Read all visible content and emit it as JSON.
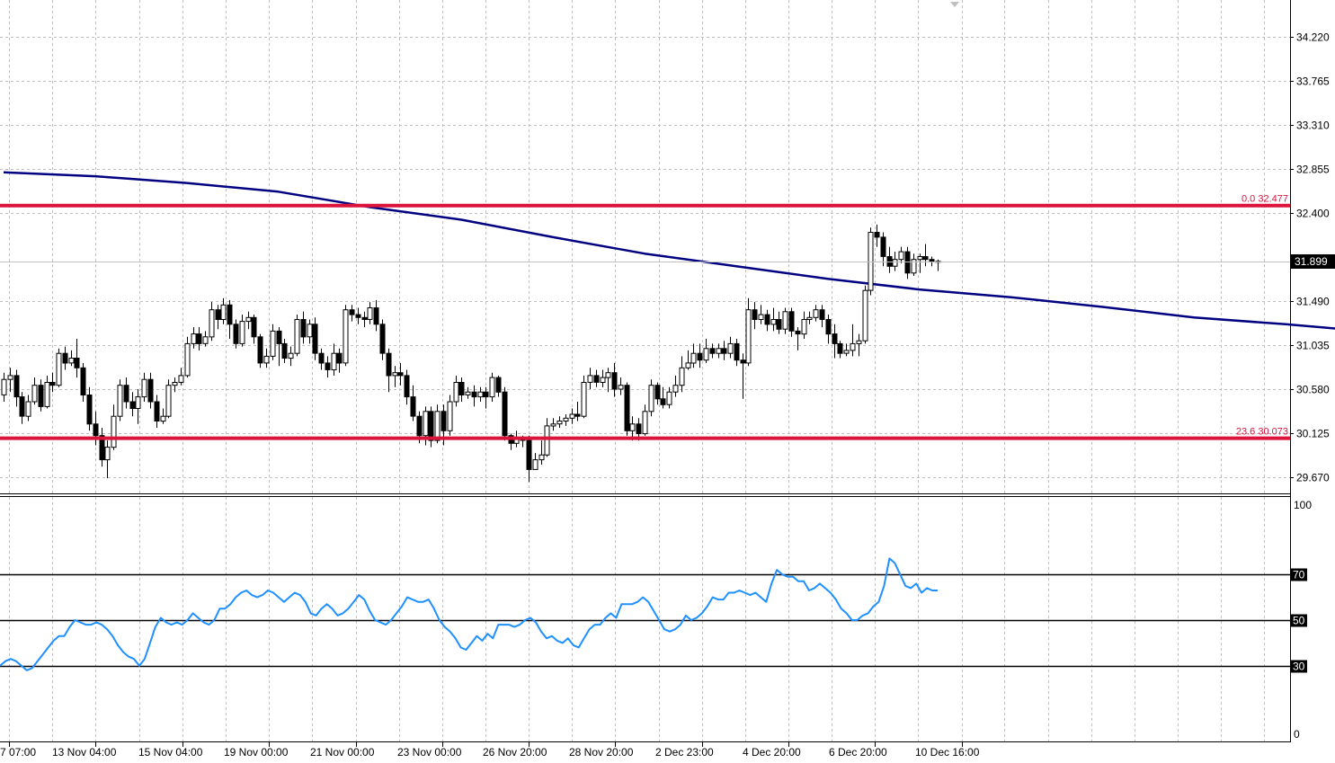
{
  "chart_data": [
    {
      "type": "candlestick",
      "panel": "price",
      "ylim": [
        29.45,
        34.6
      ],
      "y_ticks": [
        "34.220",
        "33.765",
        "33.310",
        "32.855",
        "32.400",
        "31.490",
        "31.035",
        "30.580",
        "30.125",
        "29.670"
      ],
      "current_price_label": "31.899",
      "current_price": 31.899,
      "candles": [
        [
          30.52,
          30.68,
          30.45,
          30.75
        ],
        [
          30.68,
          30.72,
          30.55,
          30.8
        ],
        [
          30.72,
          30.5,
          30.4,
          30.78
        ],
        [
          30.5,
          30.3,
          30.22,
          30.55
        ],
        [
          30.3,
          30.45,
          30.25,
          30.52
        ],
        [
          30.45,
          30.62,
          30.42,
          30.7
        ],
        [
          30.62,
          30.4,
          30.35,
          30.68
        ],
        [
          30.4,
          30.65,
          30.38,
          30.72
        ],
        [
          30.65,
          30.62,
          30.55,
          30.75
        ],
        [
          30.62,
          30.95,
          30.6,
          31.0
        ],
        [
          30.95,
          30.85,
          30.78,
          31.02
        ],
        [
          30.85,
          30.9,
          30.82,
          30.98
        ],
        [
          30.9,
          30.8,
          30.7,
          31.1
        ],
        [
          30.8,
          30.52,
          30.45,
          30.85
        ],
        [
          30.52,
          30.22,
          30.15,
          30.6
        ],
        [
          30.22,
          30.1,
          30.0,
          30.35
        ],
        [
          30.1,
          29.85,
          29.78,
          30.18
        ],
        [
          29.85,
          29.98,
          29.66,
          30.05
        ],
        [
          29.98,
          30.3,
          29.95,
          30.42
        ],
        [
          30.3,
          30.62,
          30.25,
          30.68
        ],
        [
          30.62,
          30.45,
          30.38,
          30.7
        ],
        [
          30.45,
          30.38,
          30.3,
          30.55
        ],
        [
          30.38,
          30.5,
          30.22,
          30.58
        ],
        [
          30.5,
          30.68,
          30.45,
          30.75
        ],
        [
          30.68,
          30.45,
          30.38,
          30.75
        ],
        [
          30.45,
          30.25,
          30.18,
          30.52
        ],
        [
          30.25,
          30.3,
          30.22,
          30.38
        ],
        [
          30.3,
          30.62,
          30.28,
          30.68
        ],
        [
          30.62,
          30.65,
          30.55,
          30.7
        ],
        [
          30.65,
          30.72,
          30.62,
          30.8
        ],
        [
          30.72,
          31.05,
          30.7,
          31.12
        ],
        [
          31.05,
          31.15,
          31.0,
          31.22
        ],
        [
          31.15,
          31.05,
          30.98,
          31.22
        ],
        [
          31.05,
          31.12,
          31.02,
          31.18
        ],
        [
          31.12,
          31.4,
          31.08,
          31.48
        ],
        [
          31.4,
          31.3,
          31.2,
          31.45
        ],
        [
          31.3,
          31.45,
          31.25,
          31.52
        ],
        [
          31.45,
          31.25,
          31.1,
          31.5
        ],
        [
          31.25,
          31.05,
          31.0,
          31.3
        ],
        [
          31.05,
          31.28,
          31.02,
          31.35
        ],
        [
          31.28,
          31.32,
          31.2,
          31.38
        ],
        [
          31.32,
          31.12,
          31.05,
          31.35
        ],
        [
          31.12,
          30.85,
          30.8,
          31.15
        ],
        [
          30.85,
          30.92,
          30.8,
          31.0
        ],
        [
          30.92,
          31.18,
          30.88,
          31.25
        ],
        [
          31.18,
          31.05,
          30.82,
          31.22
        ],
        [
          31.05,
          30.9,
          30.85,
          31.1
        ],
        [
          30.9,
          30.95,
          30.82,
          31.02
        ],
        [
          30.95,
          31.3,
          30.92,
          31.35
        ],
        [
          31.3,
          31.12,
          31.05,
          31.38
        ],
        [
          31.12,
          31.25,
          31.05,
          31.3
        ],
        [
          31.25,
          30.95,
          30.88,
          31.32
        ],
        [
          30.95,
          30.85,
          30.78,
          31.0
        ],
        [
          30.85,
          30.78,
          30.7,
          30.92
        ],
        [
          30.78,
          30.95,
          30.72,
          31.05
        ],
        [
          30.95,
          30.85,
          30.75,
          31.0
        ],
        [
          30.85,
          31.4,
          30.82,
          31.45
        ],
        [
          31.4,
          31.35,
          31.28,
          31.45
        ],
        [
          31.35,
          31.32,
          31.25,
          31.42
        ],
        [
          31.32,
          31.3,
          31.22,
          31.38
        ],
        [
          31.3,
          31.42,
          31.25,
          31.48
        ],
        [
          31.42,
          31.25,
          31.18,
          31.5
        ],
        [
          31.25,
          30.95,
          30.88,
          31.3
        ],
        [
          30.95,
          30.72,
          30.55,
          31.0
        ],
        [
          30.72,
          30.75,
          30.6,
          30.82
        ],
        [
          30.75,
          30.72,
          30.62,
          30.85
        ],
        [
          30.72,
          30.5,
          30.42,
          30.78
        ],
        [
          30.5,
          30.3,
          30.25,
          30.62
        ],
        [
          30.3,
          30.1,
          30.02,
          30.35
        ],
        [
          30.1,
          30.35,
          30.0,
          30.4
        ],
        [
          30.35,
          30.05,
          29.98,
          30.4
        ],
        [
          30.05,
          30.35,
          30.02,
          30.42
        ],
        [
          30.35,
          30.15,
          30.0,
          30.42
        ],
        [
          30.15,
          30.45,
          30.1,
          30.52
        ],
        [
          30.45,
          30.65,
          30.4,
          30.72
        ],
        [
          30.65,
          30.52,
          30.45,
          30.7
        ],
        [
          30.52,
          30.55,
          30.48,
          30.6
        ],
        [
          30.55,
          30.5,
          30.4,
          30.62
        ],
        [
          30.5,
          30.55,
          30.45,
          30.6
        ],
        [
          30.55,
          30.5,
          30.38,
          30.6
        ],
        [
          30.5,
          30.7,
          30.45,
          30.75
        ],
        [
          30.7,
          30.55,
          30.5,
          30.72
        ],
        [
          30.55,
          30.1,
          30.05,
          30.6
        ],
        [
          30.1,
          30.02,
          29.95,
          30.12
        ],
        [
          30.02,
          30.08,
          29.98,
          30.15
        ],
        [
          30.08,
          30.05,
          29.98,
          30.1
        ],
        [
          30.05,
          29.75,
          29.62,
          30.1
        ],
        [
          29.75,
          29.85,
          29.78,
          29.92
        ],
        [
          29.85,
          29.9,
          29.8,
          30.05
        ],
        [
          29.9,
          30.2,
          29.88,
          30.28
        ],
        [
          30.2,
          30.22,
          30.15,
          30.28
        ],
        [
          30.22,
          30.25,
          30.18,
          30.3
        ],
        [
          30.25,
          30.28,
          30.2,
          30.32
        ],
        [
          30.28,
          30.32,
          30.22,
          30.38
        ],
        [
          30.32,
          30.3,
          30.25,
          30.45
        ],
        [
          30.3,
          30.65,
          30.28,
          30.72
        ],
        [
          30.65,
          30.72,
          30.58,
          30.8
        ],
        [
          30.72,
          30.65,
          30.6,
          30.78
        ],
        [
          30.65,
          30.7,
          30.6,
          30.78
        ],
        [
          30.7,
          30.75,
          30.55,
          30.8
        ],
        [
          30.75,
          30.58,
          30.5,
          30.85
        ],
        [
          30.58,
          30.62,
          30.52,
          30.7
        ],
        [
          30.62,
          30.15,
          30.1,
          30.65
        ],
        [
          30.15,
          30.22,
          30.05,
          30.3
        ],
        [
          30.22,
          30.12,
          30.05,
          30.28
        ],
        [
          30.12,
          30.35,
          30.1,
          30.42
        ],
        [
          30.35,
          30.62,
          30.3,
          30.68
        ],
        [
          30.62,
          30.48,
          30.42,
          30.65
        ],
        [
          30.48,
          30.42,
          30.38,
          30.6
        ],
        [
          30.42,
          30.55,
          30.38,
          30.6
        ],
        [
          30.55,
          30.62,
          30.5,
          30.72
        ],
        [
          30.62,
          30.8,
          30.55,
          30.92
        ],
        [
          30.8,
          30.85,
          30.78,
          30.98
        ],
        [
          30.85,
          30.95,
          30.8,
          31.05
        ],
        [
          30.95,
          30.88,
          30.8,
          31.05
        ],
        [
          30.88,
          31.0,
          30.85,
          31.1
        ],
        [
          31.0,
          30.95,
          30.9,
          31.05
        ],
        [
          30.95,
          31.0,
          30.9,
          31.05
        ],
        [
          31.0,
          30.95,
          30.88,
          31.08
        ],
        [
          30.95,
          31.05,
          30.9,
          31.12
        ],
        [
          31.05,
          30.88,
          30.82,
          31.1
        ],
        [
          30.88,
          30.85,
          30.48,
          30.95
        ],
        [
          30.85,
          31.4,
          30.82,
          31.52
        ],
        [
          31.4,
          31.3,
          31.2,
          31.48
        ],
        [
          31.3,
          31.35,
          31.25,
          31.45
        ],
        [
          31.35,
          31.25,
          31.18,
          31.4
        ],
        [
          31.25,
          31.3,
          31.18,
          31.42
        ],
        [
          31.3,
          31.2,
          31.15,
          31.38
        ],
        [
          31.2,
          31.38,
          31.15,
          31.42
        ],
        [
          31.38,
          31.18,
          31.12,
          31.42
        ],
        [
          31.18,
          31.15,
          30.98,
          31.22
        ],
        [
          31.15,
          31.3,
          31.1,
          31.38
        ],
        [
          31.3,
          31.32,
          31.25,
          31.38
        ],
        [
          31.32,
          31.4,
          31.28,
          31.45
        ],
        [
          31.4,
          31.3,
          31.22,
          31.45
        ],
        [
          31.3,
          31.15,
          31.05,
          31.35
        ],
        [
          31.15,
          31.05,
          30.9,
          31.25
        ],
        [
          31.05,
          30.95,
          30.9,
          31.08
        ],
        [
          30.95,
          30.98,
          30.92,
          31.05
        ],
        [
          30.98,
          31.05,
          30.92,
          31.25
        ],
        [
          31.05,
          31.08,
          30.92,
          31.15
        ],
        [
          31.08,
          31.6,
          31.05,
          31.65
        ],
        [
          31.6,
          32.2,
          31.55,
          32.25
        ],
        [
          32.2,
          32.15,
          32.05,
          32.28
        ],
        [
          32.15,
          31.95,
          31.85,
          32.2
        ],
        [
          31.95,
          31.85,
          31.78,
          32.05
        ],
        [
          31.85,
          31.92,
          31.8,
          32.0
        ],
        [
          31.92,
          32.0,
          31.88,
          32.05
        ],
        [
          32.0,
          31.78,
          31.72,
          32.05
        ],
        [
          31.78,
          31.92,
          31.75,
          31.98
        ],
        [
          31.92,
          31.95,
          31.78,
          31.98
        ],
        [
          31.95,
          31.92,
          31.85,
          32.08
        ],
        [
          31.92,
          31.9,
          31.85,
          31.95
        ],
        [
          31.9,
          31.899,
          31.8,
          31.92
        ]
      ],
      "moving_average": [
        [
          0,
          32.82
        ],
        [
          15,
          32.78
        ],
        [
          30,
          32.71
        ],
        [
          45,
          32.62
        ],
        [
          60,
          32.46
        ],
        [
          75,
          32.33
        ],
        [
          90,
          32.15
        ],
        [
          105,
          31.98
        ],
        [
          120,
          31.85
        ],
        [
          135,
          31.72
        ],
        [
          150,
          31.61
        ],
        [
          165,
          31.53
        ],
        [
          180,
          31.43
        ],
        [
          195,
          31.32
        ],
        [
          210,
          31.25
        ],
        [
          225,
          31.17
        ],
        [
          240,
          31.08
        ],
        [
          255,
          31.02
        ],
        [
          270,
          30.96
        ],
        [
          285,
          30.92
        ],
        [
          300,
          30.86
        ],
        [
          315,
          30.8
        ],
        [
          330,
          30.74
        ],
        [
          345,
          30.7
        ],
        [
          360,
          30.68
        ]
      ],
      "levels": [
        {
          "label": "0.0 32.477",
          "value": 32.477
        },
        {
          "label": "23.6 30.073",
          "value": 30.073
        }
      ],
      "x_tick_labels": [
        "7 07:00",
        "13 Nov 04:00",
        "15 Nov 04:00",
        "19 Nov 00:00",
        "21 Nov 00:00",
        "23 Nov 00:00",
        "26 Nov 20:00",
        "28 Nov 20:00",
        "2 Dec 23:00",
        "4 Dec 20:00",
        "6 Dec 20:00",
        "10 Dec 16:00"
      ]
    },
    {
      "type": "line",
      "panel": "oscillator",
      "ylim": [
        0,
        100
      ],
      "y_ticks": [
        "100",
        "0"
      ],
      "levels": [
        {
          "label": "70",
          "value": 70
        },
        {
          "label": "50",
          "value": 50
        },
        {
          "label": "30",
          "value": 30
        }
      ],
      "values": [
        30,
        32,
        33,
        32,
        30,
        28,
        29,
        32,
        35,
        38,
        41,
        43,
        43,
        47,
        50,
        49,
        48,
        48,
        49,
        48,
        46,
        43,
        39,
        36,
        34,
        33,
        30,
        33,
        40,
        47,
        51,
        49,
        48,
        49,
        48,
        50,
        53,
        51,
        49,
        48,
        50,
        55,
        55,
        57,
        60,
        62,
        63,
        61,
        60,
        61,
        63,
        62,
        60,
        58,
        60,
        62,
        61,
        58,
        53,
        52,
        55,
        57,
        55,
        52,
        53,
        55,
        58,
        61,
        59,
        54,
        50,
        49,
        48,
        50,
        53,
        56,
        60,
        59,
        58,
        58,
        59,
        55,
        50,
        47,
        45,
        42,
        38,
        37,
        40,
        43,
        41,
        44,
        42,
        48,
        48,
        48,
        47,
        48,
        50,
        51,
        49,
        45,
        42,
        43,
        41,
        40,
        42,
        39,
        38,
        42,
        46,
        48,
        48,
        51,
        53,
        51,
        57,
        57,
        57,
        58,
        60,
        58,
        54,
        50,
        46,
        45,
        46,
        48,
        52,
        50,
        51,
        53,
        56,
        60,
        59,
        59,
        62,
        62,
        63,
        62,
        61,
        62,
        60,
        58,
        66,
        72,
        70,
        69,
        69,
        67,
        67,
        63,
        64,
        66,
        64,
        62,
        59,
        55,
        53,
        50,
        50,
        52,
        53,
        56,
        58,
        65,
        77,
        75,
        70,
        65,
        64,
        66,
        62,
        64,
        63,
        63
      ]
    }
  ]
}
